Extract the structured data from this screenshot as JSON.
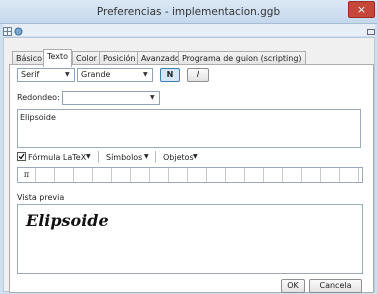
{
  "window": {
    "title": "Preferencias - implementacion.ggb",
    "close_glyph": "×"
  },
  "tabs": [
    {
      "label": "Básico"
    },
    {
      "label": "Texto"
    },
    {
      "label": "Color"
    },
    {
      "label": "Posición"
    },
    {
      "label": "Avanzado"
    },
    {
      "label": "Programa de guion (scripting)"
    }
  ],
  "text_tab": {
    "font_family_value": "Serif",
    "font_size_value": "Grande",
    "bold_label": "N",
    "italic_label": "I",
    "rounding_label": "Redondeo:",
    "rounding_value": "",
    "text_value": "Elipsoide",
    "latex_label": "Fórmula LaTeX",
    "symbols_label": "Símbolos",
    "objects_label": "Objetos",
    "symbol_pi": "π",
    "preview_label": "Vista previa",
    "preview_text": "Elipsoide"
  },
  "buttons": {
    "ok": "OK",
    "cancel": "Cancela"
  }
}
